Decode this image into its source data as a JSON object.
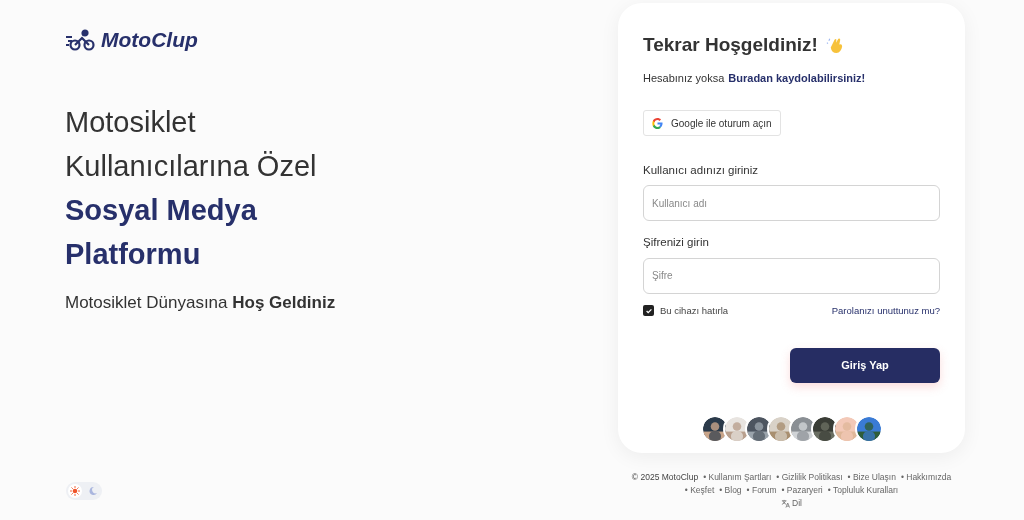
{
  "brand": {
    "name": "MotoClup"
  },
  "hero": {
    "lines": [
      "Motosiklet",
      "Kullanıcılarına Özel"
    ],
    "accent_lines": [
      "Sosyal Medya",
      "Platformu"
    ],
    "tagline": "Motosiklet Dünyasına **Hoş Geldiniz**"
  },
  "theme_toggle": [
    {
      "kind": "light",
      "selected": true
    },
    {
      "kind": "dark",
      "selected": false
    }
  ],
  "login": {
    "title": "Tekrar Hoşgeldiniz!",
    "signup_prompt": "Hesabınız yoksa",
    "signup_link": "Buradan kaydolabilirsiniz!",
    "google_button": "Google ile oturum açın",
    "username_label": "Kullanıcı adınızı giriniz",
    "username": {
      "placeholder": "Kullanıcı adı"
    },
    "password_label": "Şifrenizi girin",
    "password": {
      "placeholder": "Şifre"
    },
    "remember": {
      "label": "Bu cihazı hatırla",
      "checked": true
    },
    "forgot_link": "Parolanızı unuttunuz mu?",
    "submit": "Giriş Yap"
  },
  "footer": {
    "copyright": "© 2025 MotoClup",
    "links_row_1": [
      "• Kullanım Şartları",
      "• Gizlilik Politikası",
      "• Bize Ulaşın",
      "• Hakkımızda"
    ],
    "links_row_2": [
      "• Keşfet",
      "• Blog",
      "• Forum",
      "• Pazaryeri",
      "• Topluluk Kuralları"
    ],
    "language": "Dil"
  }
}
